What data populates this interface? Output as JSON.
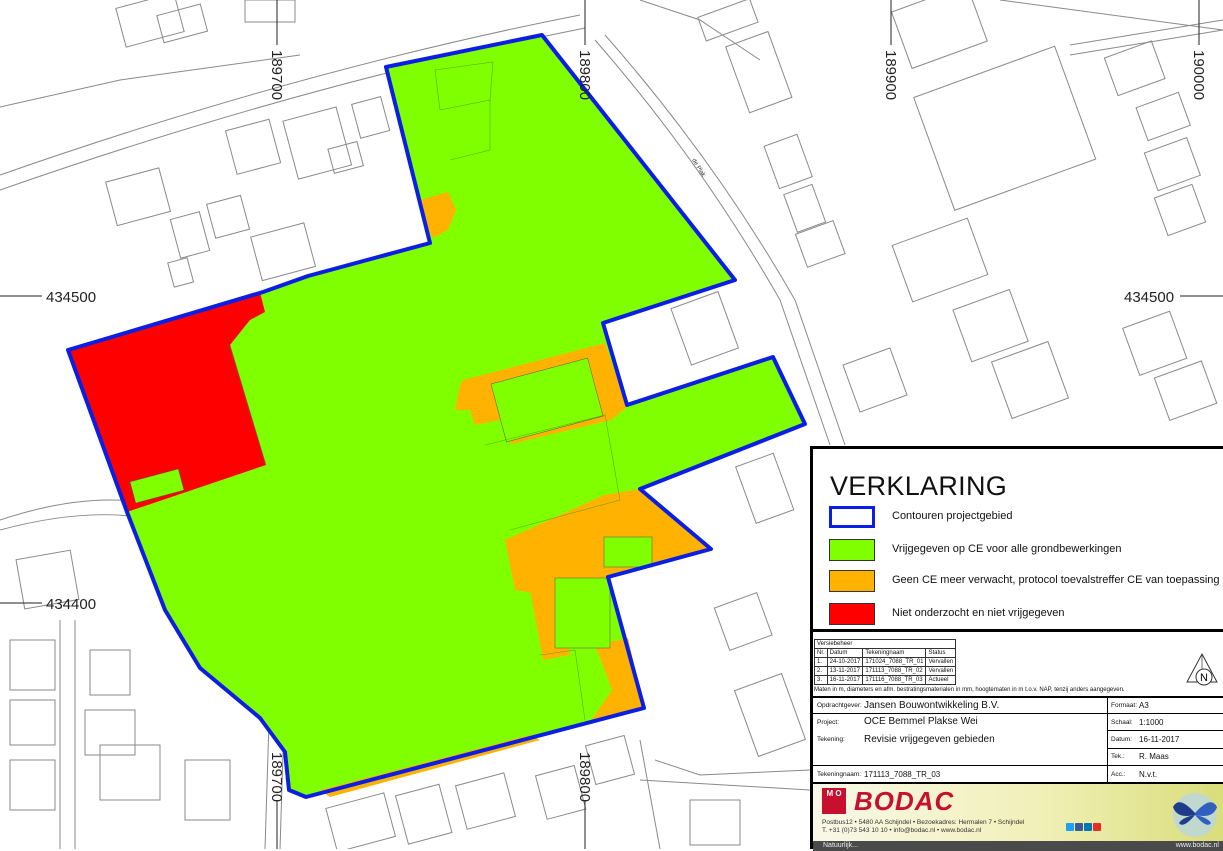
{
  "map": {
    "grid_labels": {
      "x_top": [
        "189700",
        "189800",
        "189900",
        "190000"
      ],
      "x_bottom": [
        "189700",
        "189800"
      ],
      "y_left": [
        "434500",
        "434400"
      ],
      "y_right": [
        "434500"
      ]
    },
    "street_label": "de Plak",
    "colors": {
      "boundary": "#0a1ee6",
      "green": "#80ff00",
      "orange": "#ffb300",
      "red": "#ff0000",
      "basemap": "#8a8a8a"
    }
  },
  "legend": {
    "title": "VERKLARING",
    "items": [
      {
        "label": "Contouren projectgebied",
        "symbol": "boundary-swatch"
      },
      {
        "label": "Vrijgegeven op CE voor alle grondbewerkingen",
        "color": "#80ff00"
      },
      {
        "label": "Geen CE meer verwacht, protocol toevalstreffer CE van toepassing",
        "color": "#ffb300"
      },
      {
        "label": "Niet onderzocht en niet vrijgegeven",
        "color": "#ff0000"
      }
    ]
  },
  "titleblock": {
    "version_title": "Versiebeheer",
    "version_headers": [
      "Nr.",
      "Datum",
      "Tekeningnaam",
      "Status"
    ],
    "versions": [
      [
        "1.",
        "24-10-2017",
        "171024_7088_TR_01",
        "Vervallen"
      ],
      [
        "2.",
        "13-11-2017",
        "171113_7088_TR_02",
        "Vervallen"
      ],
      [
        "3.",
        "16-11-2017",
        "171116_7088_TR_03",
        "Actueel"
      ]
    ],
    "note": "Maten in m, diameters en afm. bestratingsmaterialen in mm, hoogtematen in m t.o.v. NAP, tenzij anders aangegeven.",
    "north_label": "N",
    "opdrachtgever_label": "Opdrachtgever:",
    "opdrachtgever": "Jansen Bouwontwikkeling B.V.",
    "project_label": "Project:",
    "project": "OCE Bemmel Plakse Wei",
    "tekening_label": "Tekening:",
    "tekening": "Revisie vrijgegeven gebieden",
    "tekeningnaam_label": "Tekeningnaam:",
    "tekeningnaam": "171113_7088_TR_03",
    "formaat_label": "Formaat:",
    "formaat": "A3",
    "schaal_label": "Schaal:",
    "schaal": "1:1000",
    "datum_label": "Datum:",
    "datum": "16-11-2017",
    "tek_label": "Tek.:",
    "tek": "R. Maas",
    "acc_label": "Acc.:",
    "acc": "N.v.t."
  },
  "company": {
    "logo_letters": "M O",
    "name": "BODAC",
    "address": "Postbus12 • 5480 AA Schijndel • Bezoekadres: Hermalen 7 • Schijndel",
    "contact": "T. +31 (0)73 543 10 10 • info@bodac.nl • www.bodac.nl",
    "slogan": "Natuurlijk...",
    "website": "www.bodac.nl"
  }
}
